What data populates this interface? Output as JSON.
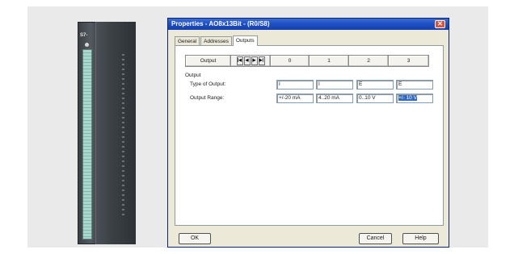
{
  "dialog": {
    "title": "Properties - AO8x13Bit - (R0/S8)",
    "close_icon": "close-icon",
    "tabs": [
      {
        "label": "General",
        "active": false
      },
      {
        "label": "Addresses",
        "active": false
      },
      {
        "label": "Outputs",
        "active": true
      }
    ],
    "grid": {
      "header_label": "Output",
      "nav_icons": [
        "first-icon",
        "prev-icon",
        "next-icon",
        "last-icon"
      ],
      "nav_glyphs": [
        "|◀",
        "◀",
        "▶",
        "▶|"
      ],
      "columns": [
        "0",
        "1",
        "2",
        "3"
      ]
    },
    "section_label": "Output",
    "rows": [
      {
        "label": "Type of Output:",
        "values": [
          "I",
          "I",
          "E",
          "E"
        ]
      },
      {
        "label": "Output Range:",
        "values": [
          "+/-20 mA",
          "4..20 mA",
          "0..10 V",
          "+/- 10 V"
        ]
      }
    ],
    "selected_cell": {
      "row": 1,
      "col": 3
    },
    "buttons": {
      "ok": "OK",
      "cancel": "Cancel",
      "help": "Help"
    }
  },
  "module": {
    "label": "S7-"
  },
  "colors": {
    "titlebar": "#1c4fc4",
    "dialog_bg": "#ece9d8",
    "selection": "#316ac5"
  }
}
